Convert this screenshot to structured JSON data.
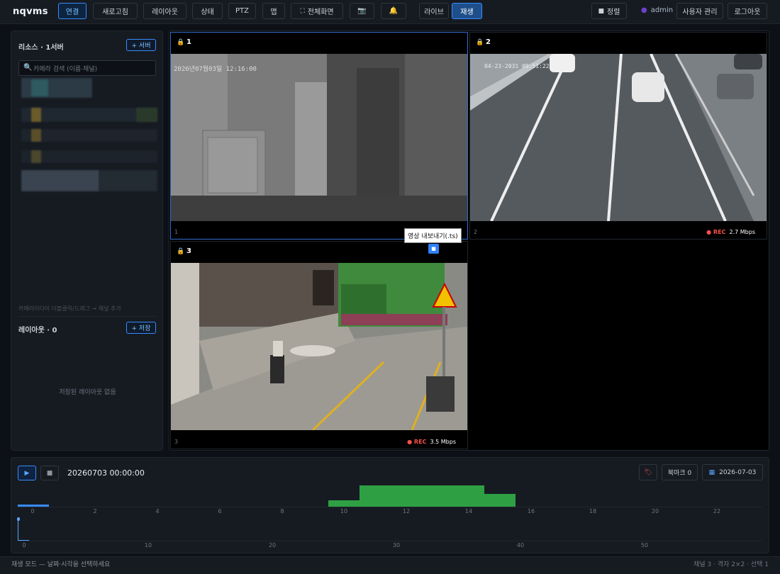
{
  "app": {
    "brand": "nqvms"
  },
  "toolbar": {
    "connect": "연결",
    "refresh": "새로고침",
    "layout": "레이아웃",
    "status": "상태",
    "ptz": "PTZ",
    "map": "맵",
    "fullscreen": "전체화면",
    "live": "라이브",
    "playback": "재생",
    "sort": "정렬",
    "user": "admin",
    "user_admin": "사용자 관리",
    "logout": "로그아웃"
  },
  "sidebar": {
    "resources_title": "리소스 · 1서버",
    "add_server": "+ 서버",
    "search_placeholder": "카메라 검색 (이름·채널)",
    "hint": "카메라이다이 더블클릭/드래그 → 채널 추가",
    "layout_title": "레이아웃 · 0",
    "save_layout": "+ 저장",
    "empty_layouts": "저장된 레이아웃 없음"
  },
  "tiles": [
    {
      "num": "1",
      "footer_num": "1",
      "osd": "2026년07월03일 12:16:00",
      "rec": "",
      "bitrate": ""
    },
    {
      "num": "2",
      "footer_num": "2",
      "osd": "04-23-2031 09:51:22",
      "rec": "REC",
      "bitrate": "2.7 Mbps"
    },
    {
      "num": "3",
      "footer_num": "3",
      "osd": "",
      "rec": "REC",
      "bitrate": "3.5 Mbps"
    }
  ],
  "tooltip": "영상 내보내기(.ts)",
  "timeline": {
    "timestamp": "20260703 00:00:00",
    "bookmark": "북마크 0",
    "date": "2026-07-03",
    "hour_ticks": [
      "0",
      "2",
      "4",
      "6",
      "8",
      "10",
      "12",
      "14",
      "16",
      "18",
      "20",
      "22"
    ],
    "minute_ticks": [
      "0",
      "10",
      "20",
      "30",
      "40",
      "50"
    ]
  },
  "status": {
    "left": "재생 모드 — 날짜·시각을 선택하세요",
    "right": "채널 3 · 격자 2×2 · 선택 1"
  },
  "colors": {
    "accent": "#388bfd",
    "rec": "#f85149",
    "recording_bar": "#2ea043",
    "lock": "#e3b341"
  }
}
